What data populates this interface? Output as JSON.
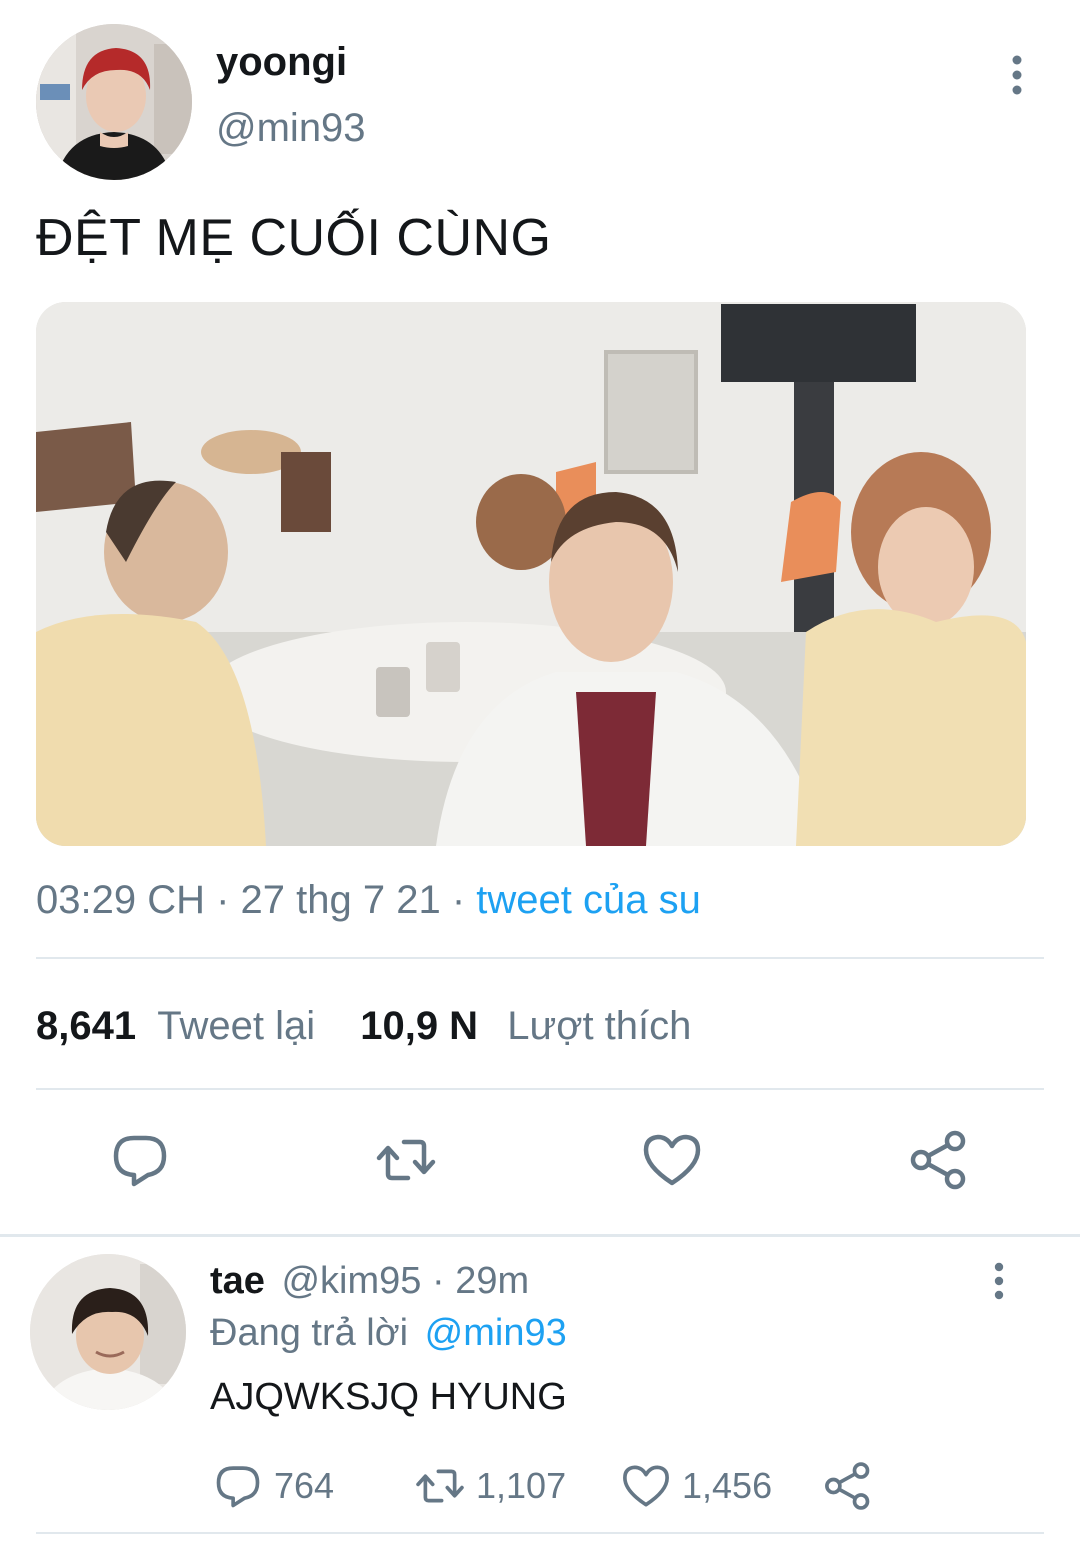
{
  "tweet": {
    "display_name": "yoongi",
    "handle": "@min93",
    "text": "ĐỆT MẸ CUỐI CÙNG",
    "time": "03:29 CH",
    "date": "27 thg 7 21",
    "source": "tweet của su",
    "retweet_count": "8,641",
    "retweet_label": "Tweet lại",
    "like_count": "10,9 N",
    "like_label": "Lượt thích"
  },
  "reply": {
    "display_name": "tae",
    "handle": "@kim95",
    "age": "29m",
    "replying_label": "Đang trả lời",
    "replying_to": "@min93",
    "text": "AJQWKSJQ HYUNG",
    "reply_count": "764",
    "retweet_count": "1,107",
    "like_count": "1,456"
  },
  "icons": {
    "reply": "comment-icon",
    "retweet": "retweet-icon",
    "like": "heart-icon",
    "share": "share-icon",
    "more": "more-vertical-icon"
  },
  "colors": {
    "accent": "#1da1f2",
    "secondary_text": "#657786",
    "divider": "#e1e8ed"
  }
}
